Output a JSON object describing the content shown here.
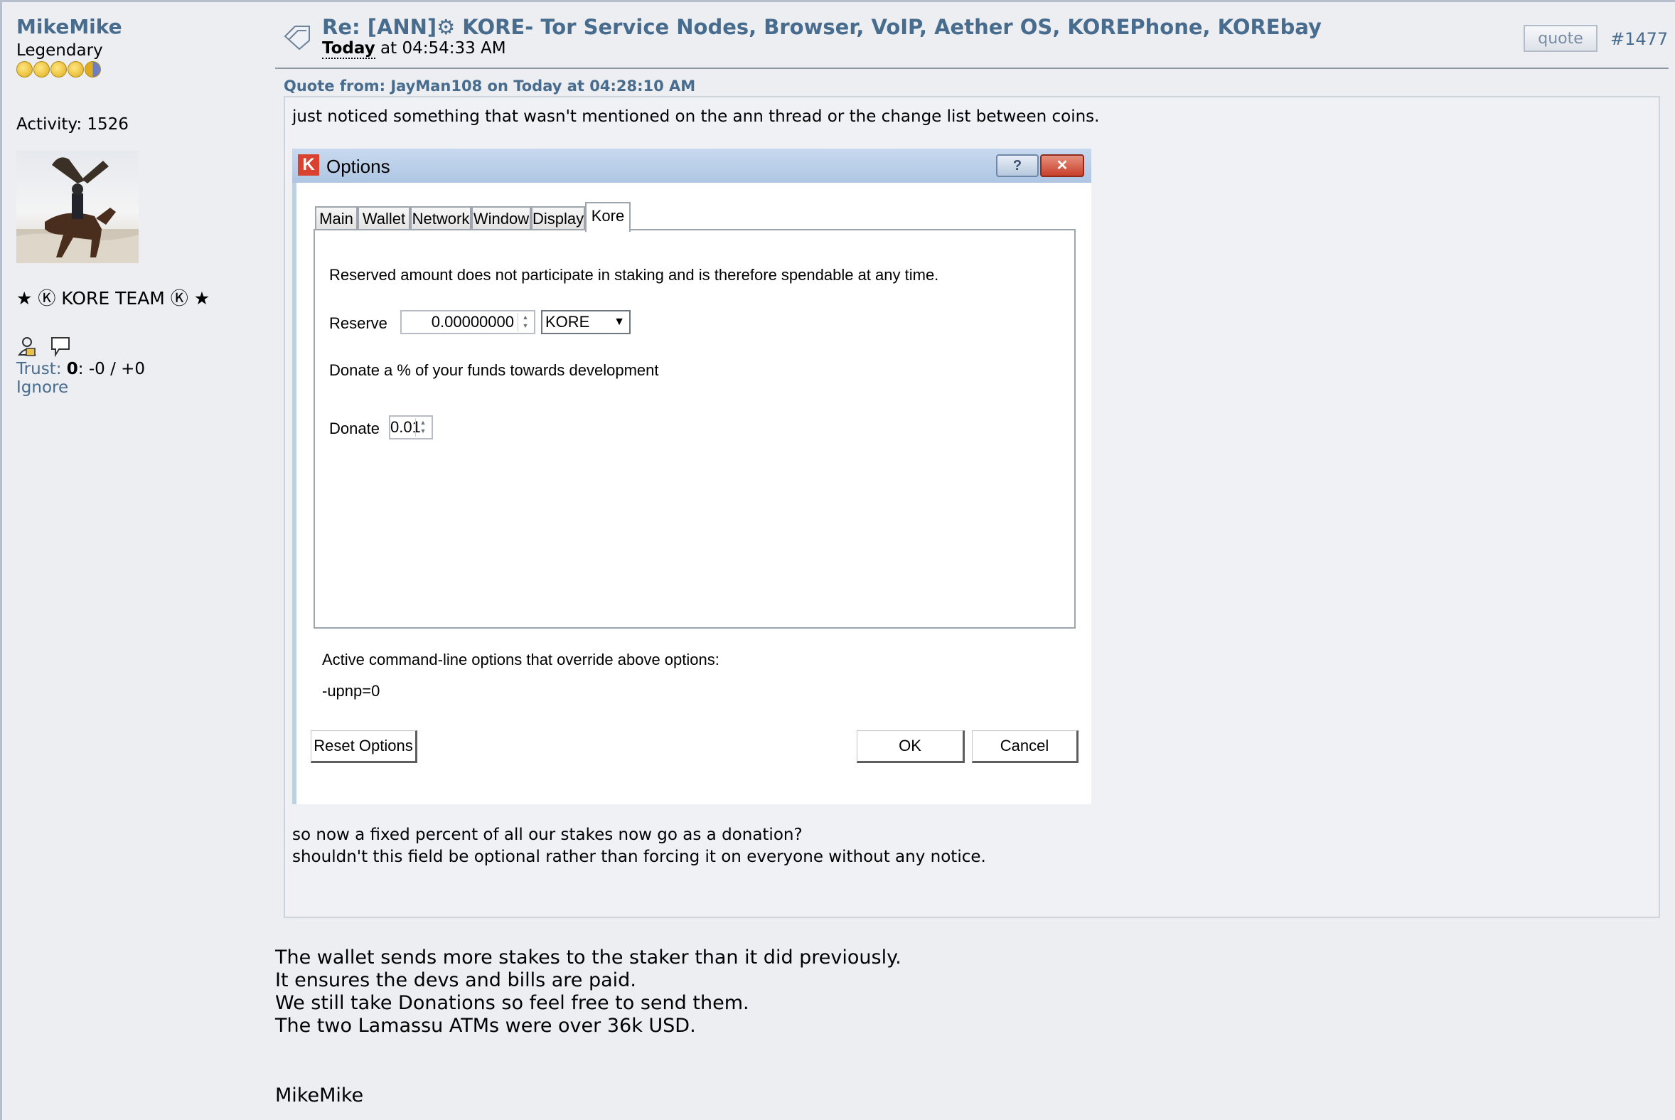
{
  "poster": {
    "name": "MikeMike",
    "rank": "Legendary",
    "activity": "Activity: 1526",
    "team": "★ Ⓚ KORE TEAM Ⓚ ★",
    "trust_label": "Trust:",
    "trust_score": "0",
    "trust_rest": ": -0 / +0",
    "ignore": "Ignore"
  },
  "post": {
    "title": "Re: [ANN]⚙ KORE- Tor Service Nodes, Browser, VoIP, Aether OS, KOREPhone, KOREbay",
    "date_bold": "Today",
    "date_rest": " at 04:54:33 AM",
    "quote_button": "quote",
    "number": "#1477",
    "quote_header": "Quote from: JayMan108 on Today at 04:28:10 AM",
    "quote_line1": "just noticed something that wasn't mentioned on the ann thread or the change list between coins.",
    "quote_line2": "so now a fixed percent of all our stakes now go as a donation?",
    "quote_line3": "shouldn't this field be optional rather than forcing it on everyone without any notice.",
    "body_lines": [
      "The wallet sends more stakes to the staker than it did previously.",
      "It ensures the devs and bills are paid.",
      "We still take Donations so feel free to send them.",
      "The two Lamassu ATMs were over 36k USD."
    ],
    "signature": "MikeMike"
  },
  "dialog": {
    "title": "Options",
    "help_glyph": "?",
    "close_glyph": "✕",
    "logo_letter": "K",
    "tabs": [
      "Main",
      "Wallet",
      "Network",
      "Window",
      "Display",
      "Kore"
    ],
    "active_tab": "Kore",
    "reserved_note": "Reserved amount does not participate in staking and is therefore spendable at any time.",
    "reserve_label": "Reserve",
    "reserve_value": "0.00000000",
    "reserve_unit": "KORE",
    "donate_note": "Donate a % of your funds towards development",
    "donate_label": "Donate",
    "donate_value": "0.01",
    "override_note": "Active command-line options that override above options:",
    "override_value": "-upnp=0",
    "reset_button": "Reset Options",
    "ok_button": "OK",
    "cancel_button": "Cancel"
  }
}
